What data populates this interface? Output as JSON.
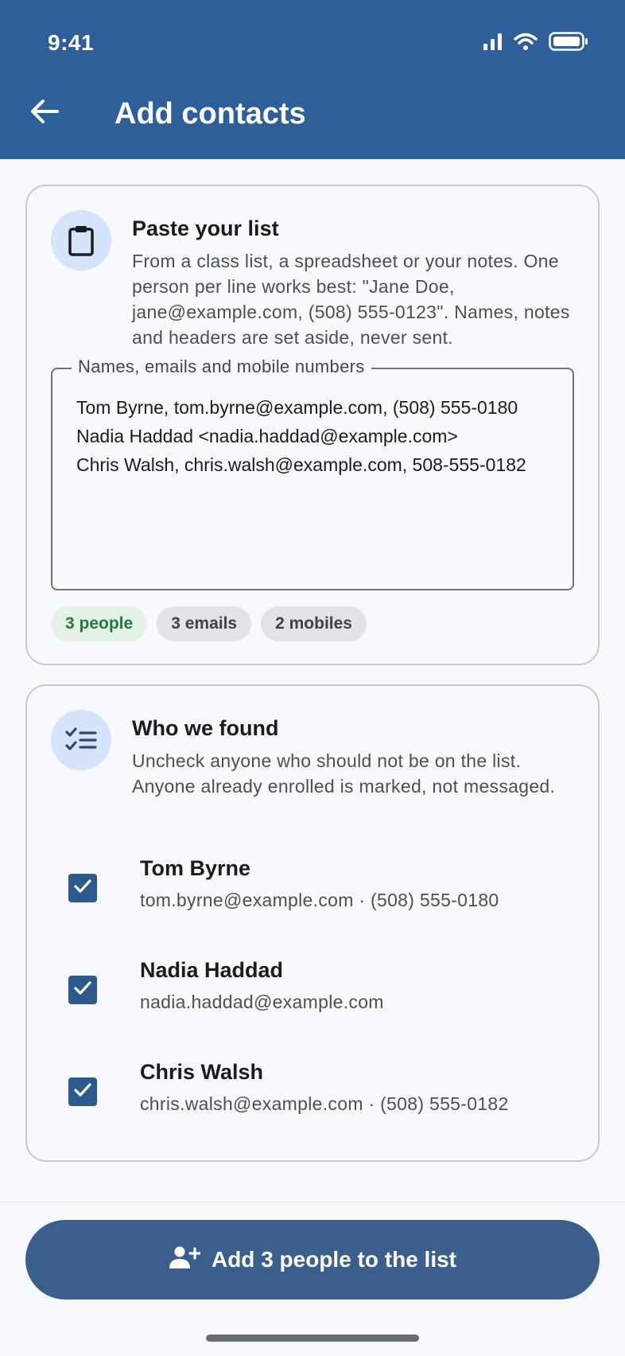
{
  "status_bar": {
    "time": "9:41",
    "icons": [
      "signal-icon",
      "wifi-icon",
      "battery-icon"
    ]
  },
  "app_bar": {
    "back_icon": "arrow-back-icon",
    "title": "Add contacts"
  },
  "paste_card": {
    "icon": "clipboard-icon",
    "title": "Paste your list",
    "description": "From a class list, a spreadsheet or your notes. One person per line works best: \"Jane Doe, jane@example.com, (508) 555-0123\". Names, notes and headers are set aside, never sent.",
    "field": {
      "label": "Names, emails and mobile numbers",
      "value": "Tom Byrne, tom.byrne@example.com, (508) 555-0180\nNadia Haddad <nadia.haddad@example.com>\nChris Walsh, chris.walsh@example.com, 508-555-0182"
    },
    "chips": {
      "people": "3 people",
      "emails": "3 emails",
      "mobiles": "2 mobiles"
    }
  },
  "found_card": {
    "icon": "checklist-icon",
    "title": "Who we found",
    "description": "Uncheck anyone who should not be on the list. Anyone already enrolled is marked, not messaged.",
    "people": [
      {
        "name": "Tom Byrne",
        "detail": "tom.byrne@example.com · (508) 555-0180",
        "checked": true
      },
      {
        "name": "Nadia Haddad",
        "detail": "nadia.haddad@example.com",
        "checked": true
      },
      {
        "name": "Chris Walsh",
        "detail": "chris.walsh@example.com · (508) 555-0182",
        "checked": true
      }
    ]
  },
  "footer": {
    "button_icon": "person-add-icon",
    "button_label": "Add 3 people to the list"
  },
  "colors": {
    "app_bar": "#2d5f9b",
    "primary_button": "#3b5f8d",
    "checkbox": "#2d5a8c",
    "chip_people_bg": "#e2f3e6",
    "chip_people_text": "#237a3c"
  }
}
